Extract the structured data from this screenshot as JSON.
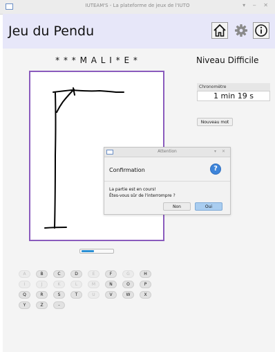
{
  "window": {
    "title": "IUTEAM'S - La plateforme de jeux de l'IUTO",
    "controls": "▾ ‒ ✕"
  },
  "header": {
    "title": "Jeu du Pendu",
    "home_icon": "home-icon",
    "settings_icon": "gear-icon",
    "info_icon": "info-icon"
  },
  "game": {
    "word": "* * * M A L I * E *",
    "level": "Niveau Difficile",
    "progress": 0.4
  },
  "chrono": {
    "label": "Chronomètre",
    "value": "1 min 19 s"
  },
  "new_word_label": "Nouveau mot",
  "keyboard": {
    "rows": [
      [
        {
          "k": "A",
          "d": true
        },
        {
          "k": "B",
          "d": false
        },
        {
          "k": "C",
          "d": false
        },
        {
          "k": "D",
          "d": false
        },
        {
          "k": "E",
          "d": true
        },
        {
          "k": "F",
          "d": false
        },
        {
          "k": "G",
          "d": true
        },
        {
          "k": "H",
          "d": false
        }
      ],
      [
        {
          "k": "I",
          "d": true
        },
        {
          "k": "J",
          "d": true
        },
        {
          "k": "K",
          "d": true
        },
        {
          "k": "L",
          "d": true
        },
        {
          "k": "M",
          "d": true
        },
        {
          "k": "N",
          "d": false
        },
        {
          "k": "O",
          "d": false
        },
        {
          "k": "P",
          "d": false
        }
      ],
      [
        {
          "k": "Q",
          "d": false
        },
        {
          "k": "R",
          "d": false
        },
        {
          "k": "S",
          "d": false
        },
        {
          "k": "T",
          "d": false
        },
        {
          "k": "U",
          "d": true
        },
        {
          "k": "V",
          "d": false
        },
        {
          "k": "W",
          "d": false
        },
        {
          "k": "X",
          "d": false
        }
      ],
      [
        {
          "k": "Y",
          "d": false
        },
        {
          "k": "Z",
          "d": false
        },
        {
          "k": "-",
          "d": false
        }
      ]
    ]
  },
  "dialog": {
    "title": "Attention",
    "controls": "▾ ✕",
    "header": "Confirmation",
    "help_icon_glyph": "?",
    "message_line1": "La partie est en cours!",
    "message_line2": " Êtes-vous sûr de l'interrompre ?",
    "no_label": "Non",
    "yes_label": "Oui"
  },
  "colors": {
    "header_bg": "#e7e7f9",
    "canvas_border": "#8a5bbd",
    "progress": "#2a8fd4",
    "dialog_default_button": "#a9cdf0",
    "help_icon": "#3d84d9"
  }
}
